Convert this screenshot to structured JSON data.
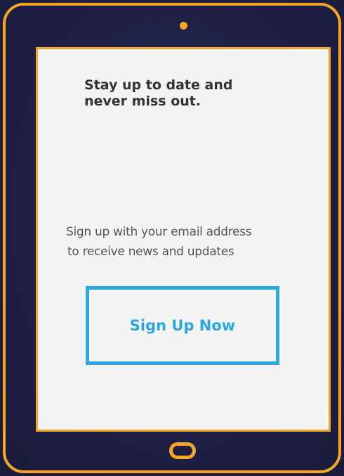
{
  "device": {
    "accent_color": "#f5a623",
    "camera_icon": "camera-dot",
    "home_icon": "home-button-pill"
  },
  "screen": {
    "headline_lines": [
      "Stay up to date and",
      "never miss out."
    ],
    "subtext_lines": [
      "Sign up with your email address",
      "to receive news and updates"
    ],
    "signup_button_label": "Sign Up Now",
    "button_color": "#2ba8e0"
  }
}
